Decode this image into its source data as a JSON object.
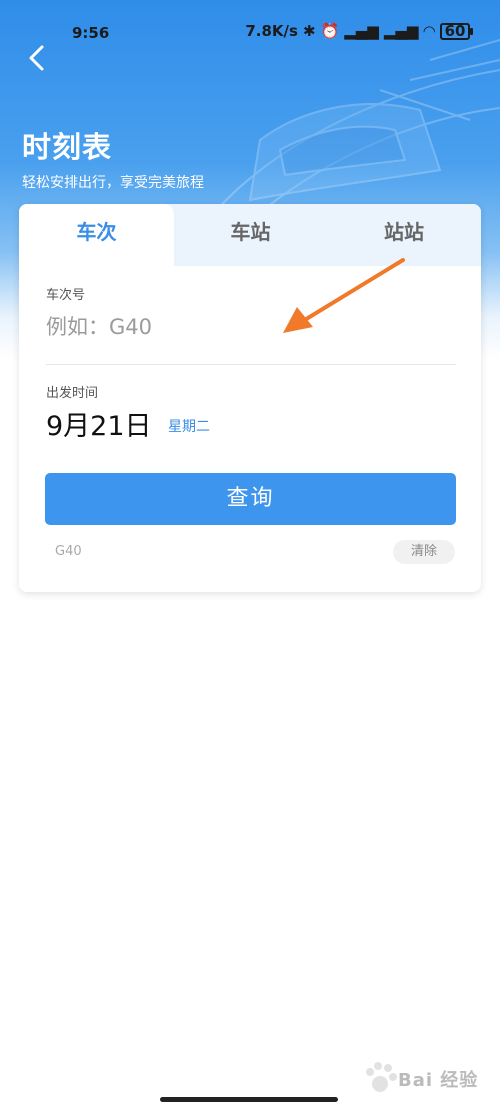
{
  "status": {
    "time": "9:56",
    "speed": "7.8K/s",
    "battery": "60"
  },
  "header": {
    "title": "时刻表",
    "subtitle": "轻松安排出行，享受完美旅程"
  },
  "tabs": [
    {
      "label": "车次",
      "active": true
    },
    {
      "label": "车站",
      "active": false
    },
    {
      "label": "站站",
      "active": false
    }
  ],
  "form": {
    "train_label": "车次号",
    "train_placeholder": "例如：G40",
    "date_label": "出发时间",
    "date_value": "9月21日",
    "weekday": "星期二",
    "query_label": "查询"
  },
  "history": {
    "items": [
      "G40"
    ],
    "clear_label": "清除"
  },
  "watermark": {
    "text": "Bai 经验"
  },
  "colors": {
    "accent": "#3a8ee6",
    "button": "#3d95ee",
    "annotation_arrow": "#f07a2a"
  }
}
